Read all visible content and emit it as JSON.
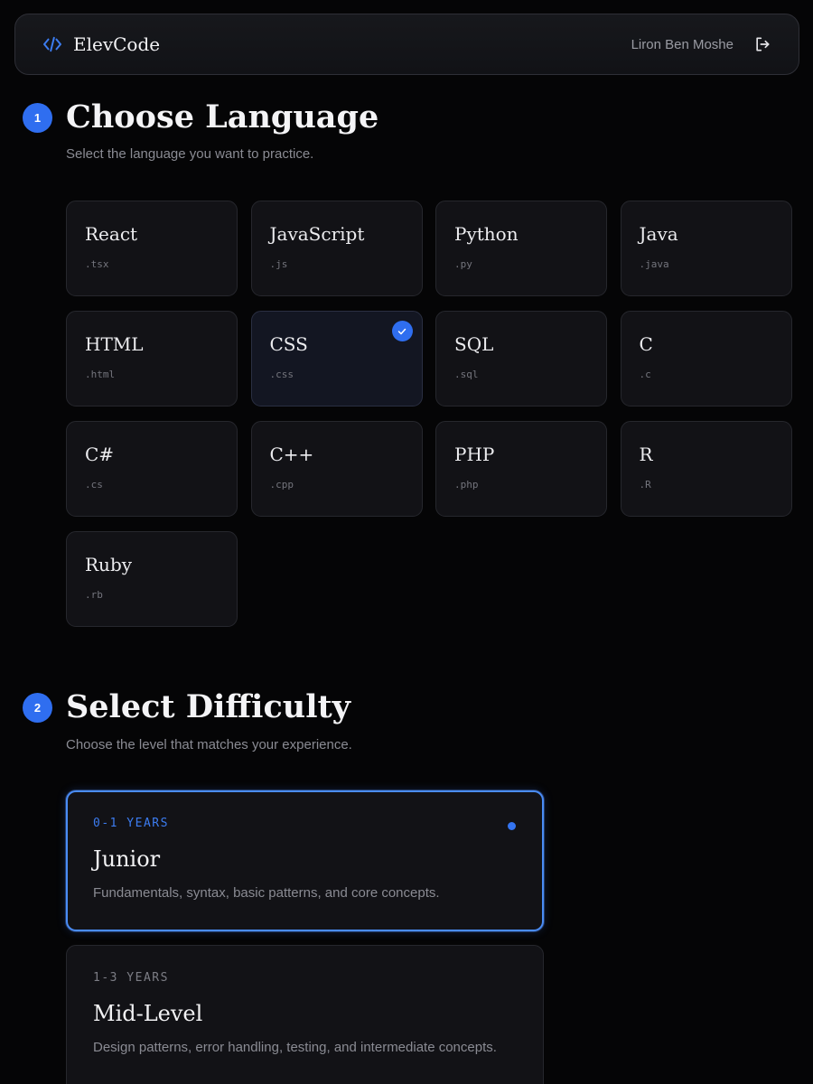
{
  "header": {
    "brand": "ElevCode",
    "user_name": "Liron Ben Moshe",
    "icons": {
      "brand": "code-brackets-icon",
      "logout": "logout-icon"
    }
  },
  "accent_color": "#2f6ef0",
  "language_section": {
    "step": "1",
    "title": "Choose Language",
    "subtitle": "Select the language you want to practice.",
    "languages": [
      {
        "name": "React",
        "ext": ".tsx"
      },
      {
        "name": "JavaScript",
        "ext": ".js"
      },
      {
        "name": "Python",
        "ext": ".py"
      },
      {
        "name": "Java",
        "ext": ".java"
      },
      {
        "name": "HTML",
        "ext": ".html"
      },
      {
        "name": "CSS",
        "ext": ".css",
        "selected": true
      },
      {
        "name": "SQL",
        "ext": ".sql"
      },
      {
        "name": "C",
        "ext": ".c"
      },
      {
        "name": "C#",
        "ext": ".cs"
      },
      {
        "name": "C++",
        "ext": ".cpp"
      },
      {
        "name": "PHP",
        "ext": ".php"
      },
      {
        "name": "R",
        "ext": ".R"
      },
      {
        "name": "Ruby",
        "ext": ".rb"
      }
    ]
  },
  "difficulty_section": {
    "step": "2",
    "title": "Select Difficulty",
    "subtitle": "Choose the level that matches your experience.",
    "levels": [
      {
        "years": "0-1 YEARS",
        "title": "Junior",
        "desc": "Fundamentals, syntax, basic patterns, and core concepts.",
        "selected": true
      },
      {
        "years": "1-3 YEARS",
        "title": "Mid-Level",
        "desc": "Design patterns, error handling, testing, and intermediate concepts."
      }
    ]
  }
}
